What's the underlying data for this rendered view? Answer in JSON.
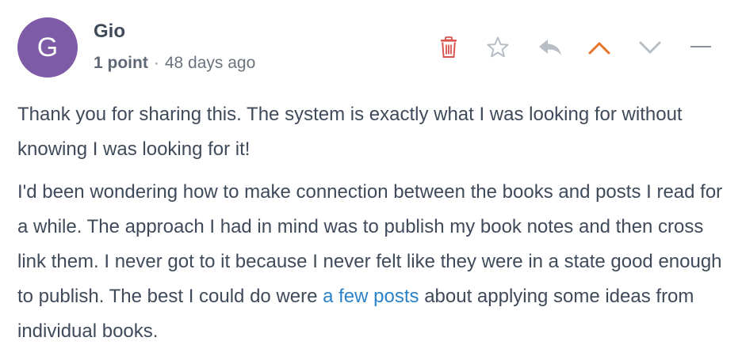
{
  "comment": {
    "avatar_letter": "G",
    "avatar_color": "#7d5ba6",
    "author": "Gio",
    "points": "1 point",
    "separator": "·",
    "age": "48 days ago",
    "paragraph1": "Thank you for sharing this. The system is exactly what I was looking for without knowing I was looking for it!",
    "paragraph2_before": "I'd been wondering how to make connection between the books and posts I read for a while. The approach I had in mind was to publish my book notes and then cross link them. I never got to it because I never felt like they were in a state good enough to publish. The best I could do were ",
    "paragraph2_link": "a few posts",
    "paragraph2_after": " about applying some ideas from individual books."
  },
  "actions": {
    "icons": [
      "trash-icon",
      "star-icon",
      "reply-icon",
      "upvote-icon",
      "downvote-icon",
      "collapse-icon"
    ],
    "colors": {
      "trash": "#d9534f",
      "upvote_active": "#e8742a",
      "muted": "#b8bec6"
    }
  }
}
